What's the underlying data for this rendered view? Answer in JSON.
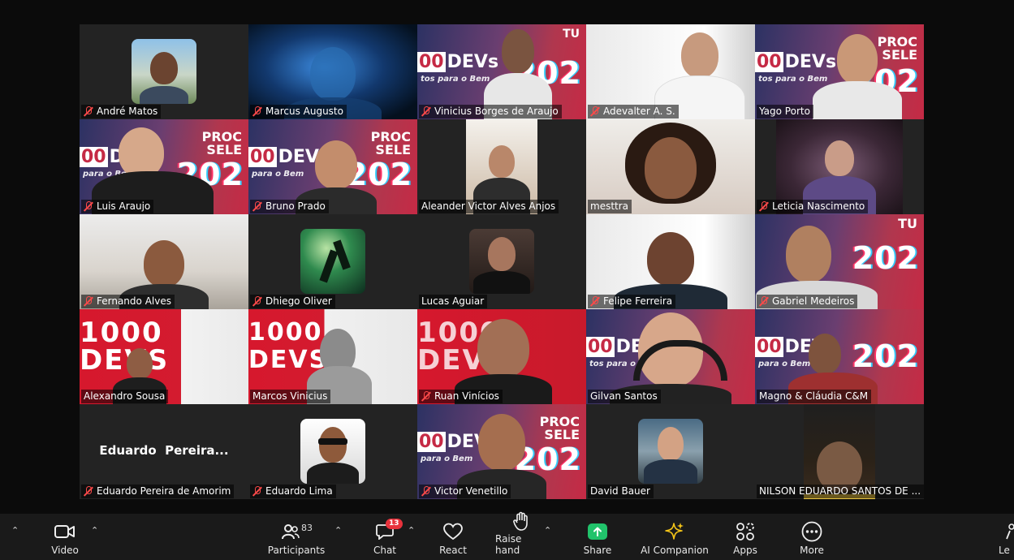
{
  "participants": [
    {
      "name": "André Matos",
      "muted": true
    },
    {
      "name": "Marcus Augusto",
      "muted": true
    },
    {
      "name": "Vinicius Borges de Araujo",
      "muted": true
    },
    {
      "name": "Adevalter A. S.",
      "muted": true
    },
    {
      "name": "Yago Porto",
      "muted": false
    },
    {
      "name": "Luis Araujo",
      "muted": true
    },
    {
      "name": "Bruno Prado",
      "muted": true
    },
    {
      "name": "Aleander Victor Alves Anjos",
      "muted": false
    },
    {
      "name": "mesttra",
      "muted": false
    },
    {
      "name": "Leticia Nascimento",
      "muted": true
    },
    {
      "name": "Fernando Alves",
      "muted": true
    },
    {
      "name": "Dhiego Oliver",
      "muted": true
    },
    {
      "name": "Lucas Aguiar",
      "muted": false
    },
    {
      "name": "Felipe Ferreira",
      "muted": true
    },
    {
      "name": "Gabriel Medeiros",
      "muted": true
    },
    {
      "name": "Alexandro Sousa",
      "muted": false
    },
    {
      "name": "Marcos Vinicius",
      "muted": false
    },
    {
      "name": "Ruan Vinícios",
      "muted": true
    },
    {
      "name": "Gilvan Santos",
      "muted": false
    },
    {
      "name": "Magno & Cláudia C&M",
      "muted": false
    },
    {
      "name": "Eduardo Pereira de Amorim",
      "muted": true,
      "center_text": "Eduardo  Pereira..."
    },
    {
      "name": "Eduardo Lima",
      "muted": true
    },
    {
      "name": "Victor Venetillo",
      "muted": true
    },
    {
      "name": "David Bauer",
      "muted": false
    },
    {
      "name": "NILSON EDUARDO SANTOS DE ...",
      "muted": false
    }
  ],
  "banner": {
    "devs": "DEVs",
    "devs_prefix": "00",
    "big": "202",
    "small_top": "PROC",
    "small_bottom": "SELE",
    "tu": "TU",
    "sub": "tos para o Bem",
    "red_big_1": "1000",
    "red_big_2": "DEVS",
    "sub_short": "para o Bem"
  },
  "toolbar": {
    "video": "Video",
    "participants": "Participants",
    "participants_count": "83",
    "chat": "Chat",
    "chat_badge": "13",
    "react": "React",
    "raise_hand": "Raise hand",
    "share": "Share",
    "ai_companion": "AI Companion",
    "apps": "Apps",
    "more": "More",
    "leave": "Le"
  },
  "colors": {
    "active_border": "#23d959",
    "muted_mic": "#ff4a4a",
    "share": "#21c36b",
    "badge": "#e8323c"
  }
}
